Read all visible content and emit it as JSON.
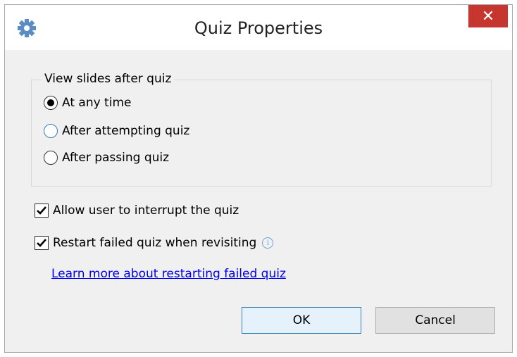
{
  "window": {
    "title": "Quiz Properties",
    "close_glyph": "✕"
  },
  "icons": {
    "settings": "gear-icon",
    "close": "close-icon",
    "info": "info-icon"
  },
  "view_slides": {
    "legend": "View slides after quiz",
    "options": [
      {
        "label": "At any time",
        "checked": true
      },
      {
        "label": "After attempting quiz",
        "checked": false
      },
      {
        "label": "After passing quiz",
        "checked": false
      }
    ]
  },
  "checkboxes": {
    "allow_interrupt": {
      "label": "Allow user to interrupt the quiz",
      "checked": true
    },
    "restart_failed": {
      "label": "Restart failed quiz when revisiting",
      "checked": true
    }
  },
  "info_glyph": "i",
  "link_text": "Learn more about restarting failed quiz",
  "buttons": {
    "ok": "OK",
    "cancel": "Cancel"
  },
  "colors": {
    "close_bg": "#c7352f",
    "link": "#0000ee",
    "accent": "#3c7fb1",
    "gear": "#5b8cc4"
  }
}
